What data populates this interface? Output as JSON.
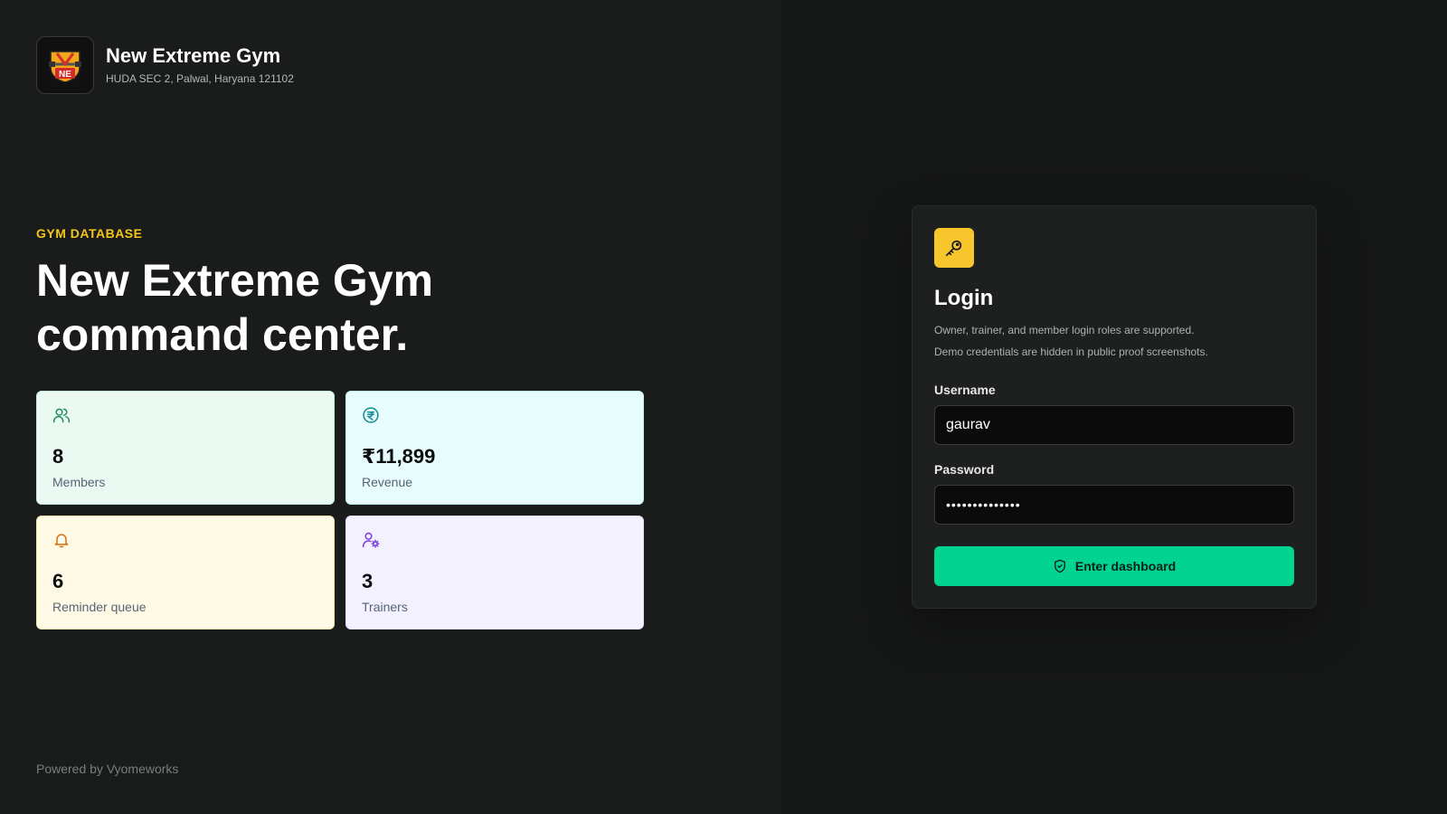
{
  "brand": {
    "logo_icon": "gym-shield-logo",
    "logo_text": "NE",
    "name": "New Extreme Gym",
    "address": "HUDA SEC 2, Palwal, Haryana 121102"
  },
  "hero": {
    "eyebrow": "GYM DATABASE",
    "headline_line1": "New Extreme Gym",
    "headline_line2": "command center."
  },
  "stats": [
    {
      "icon": "users-icon",
      "value": "8",
      "label": "Members",
      "bg": "#eafaf3",
      "border": "#c9eedd",
      "icon_color": "#1f8a63"
    },
    {
      "icon": "rupee-coin-icon",
      "value": "₹11,899",
      "label": "Revenue",
      "bg": "#e7fcfc",
      "border": "#c5f1f1",
      "icon_color": "#108c91"
    },
    {
      "icon": "bell-icon",
      "value": "6",
      "label": "Reminder queue",
      "bg": "#fffae6",
      "border": "#f6e8b0",
      "icon_color": "#d0700f"
    },
    {
      "icon": "user-cog-icon",
      "value": "3",
      "label": "Trainers",
      "bg": "#f3f1fd",
      "border": "#e1ddf8",
      "icon_color": "#7b3fe4"
    }
  ],
  "footer": {
    "powered_by": "Powered by Vyomeworks"
  },
  "login": {
    "icon": "key-icon",
    "title": "Login",
    "subtitle_line1": "Owner, trainer, and member login roles are supported.",
    "subtitle_line2": "Demo credentials are hidden in public proof screenshots.",
    "username_label": "Username",
    "username_value": "gaurav",
    "password_label": "Password",
    "password_value": "••••••••••••••",
    "submit_label": "Enter dashboard",
    "submit_icon": "shield-check-icon"
  },
  "colors": {
    "accent_yellow": "#f5c518",
    "accent_green": "#01d391",
    "left_bg": "#1a1b1b",
    "right_bg": "#161717"
  }
}
